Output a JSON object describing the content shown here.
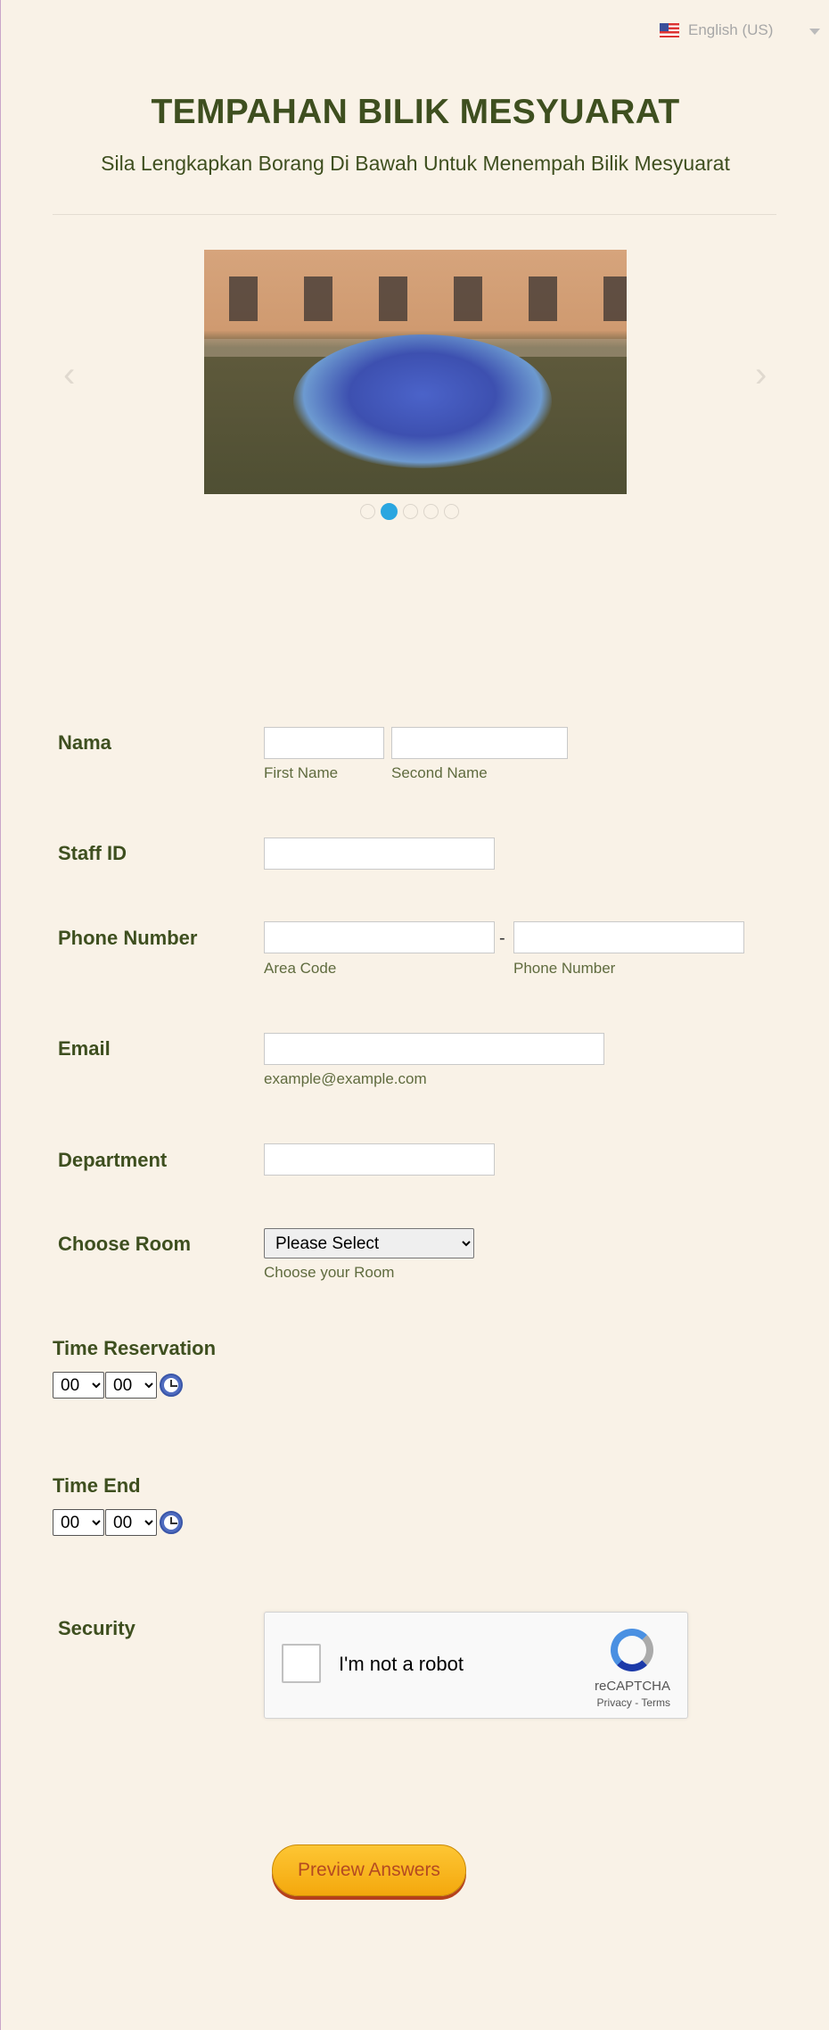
{
  "language": {
    "flag_icon": "us-flag-icon",
    "label": "English (US)"
  },
  "header": {
    "title": "TEMPAHAN BILIK MESYUARAT",
    "subtitle": "Sila Lengkapkan Borang Di Bawah Untuk Menempah Bilik Mesyuarat"
  },
  "slider": {
    "prev_icon": "chevron-left-icon",
    "next_icon": "chevron-right-icon",
    "prev_glyph": "‹",
    "next_glyph": "›",
    "dot_count": 5,
    "active_dot": 2
  },
  "form": {
    "nama": {
      "label": "Nama",
      "first_sub": "First Name",
      "second_sub": "Second Name"
    },
    "staff_id": {
      "label": "Staff ID"
    },
    "phone": {
      "label": "Phone Number",
      "dash": "-",
      "area_sub": "Area Code",
      "number_sub": "Phone Number"
    },
    "email": {
      "label": "Email",
      "sub": "example@example.com"
    },
    "department": {
      "label": "Department"
    },
    "room": {
      "label": "Choose Room",
      "selected": "Please Select",
      "sub": "Choose your Room"
    },
    "time_reservation": {
      "label": "Time Reservation",
      "hour": "00",
      "minute": "00"
    },
    "time_end": {
      "label": "Time End",
      "hour": "00",
      "minute": "00"
    },
    "security": {
      "label": "Security",
      "captcha_text": "I'm not a robot",
      "captcha_brand": "reCAPTCHA",
      "captcha_links": "Privacy - Terms"
    }
  },
  "buttons": {
    "preview": "Preview Answers"
  },
  "colors": {
    "heading": "#3e4f1f",
    "background": "#f9f2e7",
    "button": "#fdb827",
    "accent_dot": "#2aa6e0"
  }
}
